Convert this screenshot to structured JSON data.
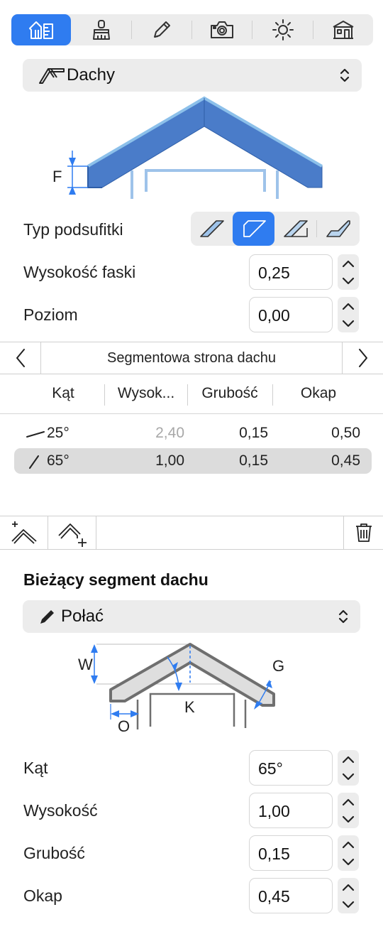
{
  "toolbar": {
    "tabs": [
      {
        "icon": "structure-icon",
        "active": true
      },
      {
        "icon": "paint-brush-icon",
        "active": false
      },
      {
        "icon": "pencil-icon",
        "active": false
      },
      {
        "icon": "camera-icon",
        "active": false
      },
      {
        "icon": "sun-icon",
        "active": false
      },
      {
        "icon": "building-icon",
        "active": false
      }
    ],
    "accent": "#2f7cf0"
  },
  "roof_type": {
    "label": "Dachy",
    "icon": "roof-icon"
  },
  "top_diagram": {
    "label_f": "F",
    "roof_color": "#4a7cc9",
    "edge_color": "#8cc0ea"
  },
  "soffit": {
    "label": "Typ podsufitki",
    "options": [
      "soffit-type-1-icon",
      "soffit-type-2-icon",
      "soffit-type-3-icon",
      "soffit-type-4-icon"
    ],
    "selected_index": 1
  },
  "fascia": {
    "label": "Wysokość faski",
    "value": "0,25"
  },
  "level": {
    "label": "Poziom",
    "value": "0,00"
  },
  "navigator": {
    "title": "Segmentowa strona dachu"
  },
  "table": {
    "headers": [
      "Kąt",
      "Wysok...",
      "Grubość",
      "Okap"
    ],
    "rows": [
      {
        "angle": "25°",
        "height": "2,40",
        "thickness": "0,15",
        "overhang": "0,50",
        "selected": false,
        "height_dim": true
      },
      {
        "angle": "65°",
        "height": "1,00",
        "thickness": "0,15",
        "overhang": "0,45",
        "selected": true,
        "height_dim": false
      }
    ]
  },
  "current_segment": {
    "title": "Bieżący segment dachu",
    "type_label": "Połać",
    "diagram": {
      "w": "W",
      "k": "K",
      "g": "G",
      "o": "O"
    },
    "fields": [
      {
        "label": "Kąt",
        "value": "65°"
      },
      {
        "label": "Wysokość",
        "value": "1,00"
      },
      {
        "label": "Grubość",
        "value": "0,15"
      },
      {
        "label": "Okap",
        "value": "0,45"
      }
    ]
  }
}
